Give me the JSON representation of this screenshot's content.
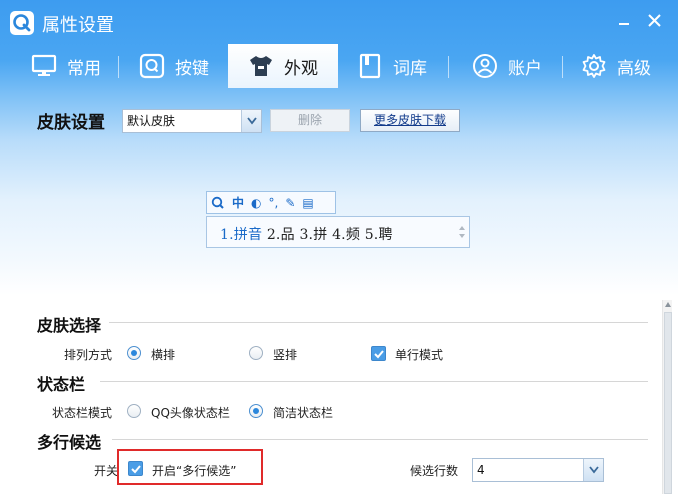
{
  "window": {
    "title": "属性设置",
    "minimize_label": "–",
    "close_label": "✕"
  },
  "tabs": [
    {
      "label": "常用",
      "icon": "monitor-icon"
    },
    {
      "label": "按键",
      "icon": "key-q-icon"
    },
    {
      "label": "外观",
      "icon": "tshirt-icon"
    },
    {
      "label": "词库",
      "icon": "book-icon"
    },
    {
      "label": "账户",
      "icon": "user-icon"
    },
    {
      "label": "高级",
      "icon": "gear-icon"
    }
  ],
  "active_tab": "外观",
  "skin": {
    "title": "皮肤设置",
    "selected": "默认皮肤",
    "delete_label": "删除",
    "more_label": "更多皮肤下载"
  },
  "ime_preview": {
    "toolbar": [
      "中",
      "◐",
      "°,",
      "✎",
      "▤"
    ],
    "candidates": [
      "1.拼音",
      "2.品",
      "3.拼",
      "4.频",
      "5.聘"
    ]
  },
  "skin_select": {
    "title": "皮肤选择",
    "layout_label": "排列方式",
    "horizontal_label": "横排",
    "vertical_label": "竖排",
    "single_line_label": "单行模式",
    "layout_value": "横排",
    "single_line_checked": true
  },
  "status_bar": {
    "title": "状态栏",
    "mode_label": "状态栏模式",
    "qq_avatar_label": "QQ头像状态栏",
    "simple_label": "简洁状态栏",
    "mode_value": "简洁状态栏"
  },
  "multi_line": {
    "title": "多行候选",
    "switch_label": "开关",
    "enable_label": "开启“多行候选”",
    "enabled": true,
    "rows_label": "候选行数",
    "rows_value": "4"
  },
  "colors": {
    "accent": "#2b87dc",
    "title_bar": "#3d9cf0",
    "highlight_box": "#e02a2a"
  }
}
